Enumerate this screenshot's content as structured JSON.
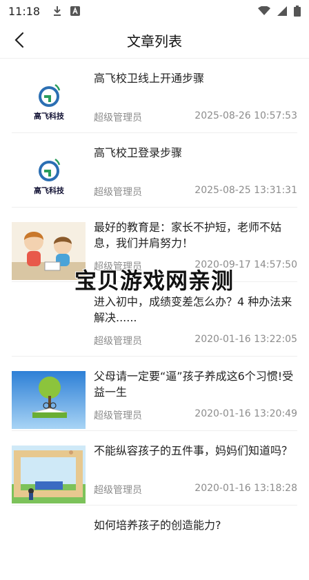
{
  "status_bar": {
    "time": "11:18"
  },
  "header": {
    "title": "文章列表"
  },
  "articles": [
    {
      "title": "高飞校卫线上开通步骤",
      "author": "超级管理员",
      "date": "2025-08-26 10:57:53",
      "thumb": "logo",
      "logo_text": "高飞科技"
    },
    {
      "title": "高飞校卫登录步骤",
      "author": "超级管理员",
      "date": "2025-08-25 13:31:31",
      "thumb": "logo",
      "logo_text": "高飞科技"
    },
    {
      "title": "最好的教育是：家长不护短，老师不姑息，我们并肩努力！",
      "author": "超级管理员",
      "date": "2020-09-17 14:57:50",
      "thumb": "teacher-child-illustration"
    },
    {
      "title": "进入初中，成绩变差怎么办？4 种办法来解决......",
      "author": "超级管理员",
      "date": "2020-01-16 13:22:05",
      "thumb": "none"
    },
    {
      "title": "父母请一定要“逼”孩子养成这6个习惯!受益一生",
      "author": "超级管理员",
      "date": "2020-01-16 13:20:49",
      "thumb": "tree-book-illustration"
    },
    {
      "title": "不能纵容孩子的五件事，妈妈们知道吗？",
      "author": "超级管理员",
      "date": "2020-01-16 13:18:28",
      "thumb": "frame-bed-illustration"
    },
    {
      "title": "如何培养孩子的创造能力?",
      "author": "",
      "date": "",
      "thumb": "none"
    }
  ],
  "watermark": "宝贝游戏网亲测",
  "colors": {
    "logo_green": "#2a9d5c",
    "logo_blue": "#2b6fb3",
    "meta_gray": "#8c8c8c"
  }
}
